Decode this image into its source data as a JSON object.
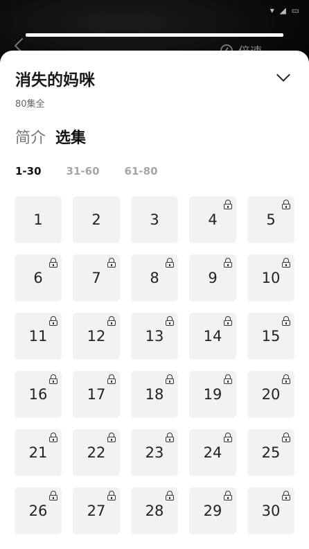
{
  "player": {
    "speed_label": "倍速"
  },
  "drama": {
    "title": "消失的妈咪",
    "episode_count": "80集全"
  },
  "tabs": [
    {
      "label": "简介",
      "active": false
    },
    {
      "label": "选集",
      "active": true
    }
  ],
  "ranges": [
    {
      "label": "1-30",
      "active": true
    },
    {
      "label": "31-60",
      "active": false
    },
    {
      "label": "61-80",
      "active": false
    }
  ],
  "episodes": [
    {
      "number": "1",
      "locked": false
    },
    {
      "number": "2",
      "locked": false
    },
    {
      "number": "3",
      "locked": false
    },
    {
      "number": "4",
      "locked": true
    },
    {
      "number": "5",
      "locked": true
    },
    {
      "number": "6",
      "locked": true
    },
    {
      "number": "7",
      "locked": true
    },
    {
      "number": "8",
      "locked": true
    },
    {
      "number": "9",
      "locked": true
    },
    {
      "number": "10",
      "locked": true
    },
    {
      "number": "11",
      "locked": true
    },
    {
      "number": "12",
      "locked": true
    },
    {
      "number": "13",
      "locked": true
    },
    {
      "number": "14",
      "locked": true
    },
    {
      "number": "15",
      "locked": true
    },
    {
      "number": "16",
      "locked": true
    },
    {
      "number": "17",
      "locked": true
    },
    {
      "number": "18",
      "locked": true
    },
    {
      "number": "19",
      "locked": true
    },
    {
      "number": "20",
      "locked": true
    },
    {
      "number": "21",
      "locked": true
    },
    {
      "number": "22",
      "locked": true
    },
    {
      "number": "23",
      "locked": true
    },
    {
      "number": "24",
      "locked": true
    },
    {
      "number": "25",
      "locked": true
    },
    {
      "number": "26",
      "locked": true
    },
    {
      "number": "27",
      "locked": true
    },
    {
      "number": "28",
      "locked": true
    },
    {
      "number": "29",
      "locked": true
    },
    {
      "number": "30",
      "locked": true
    }
  ],
  "icons": {
    "back": "back-arrow-icon",
    "speed": "speed-icon",
    "collapse": "chevron-down-icon",
    "lock": "lock-icon"
  },
  "colors": {
    "sheet_bg": "#ffffff",
    "tile_bg": "#f2f2f5",
    "active_text": "#111111",
    "inactive_range": "#a6a6a6"
  }
}
